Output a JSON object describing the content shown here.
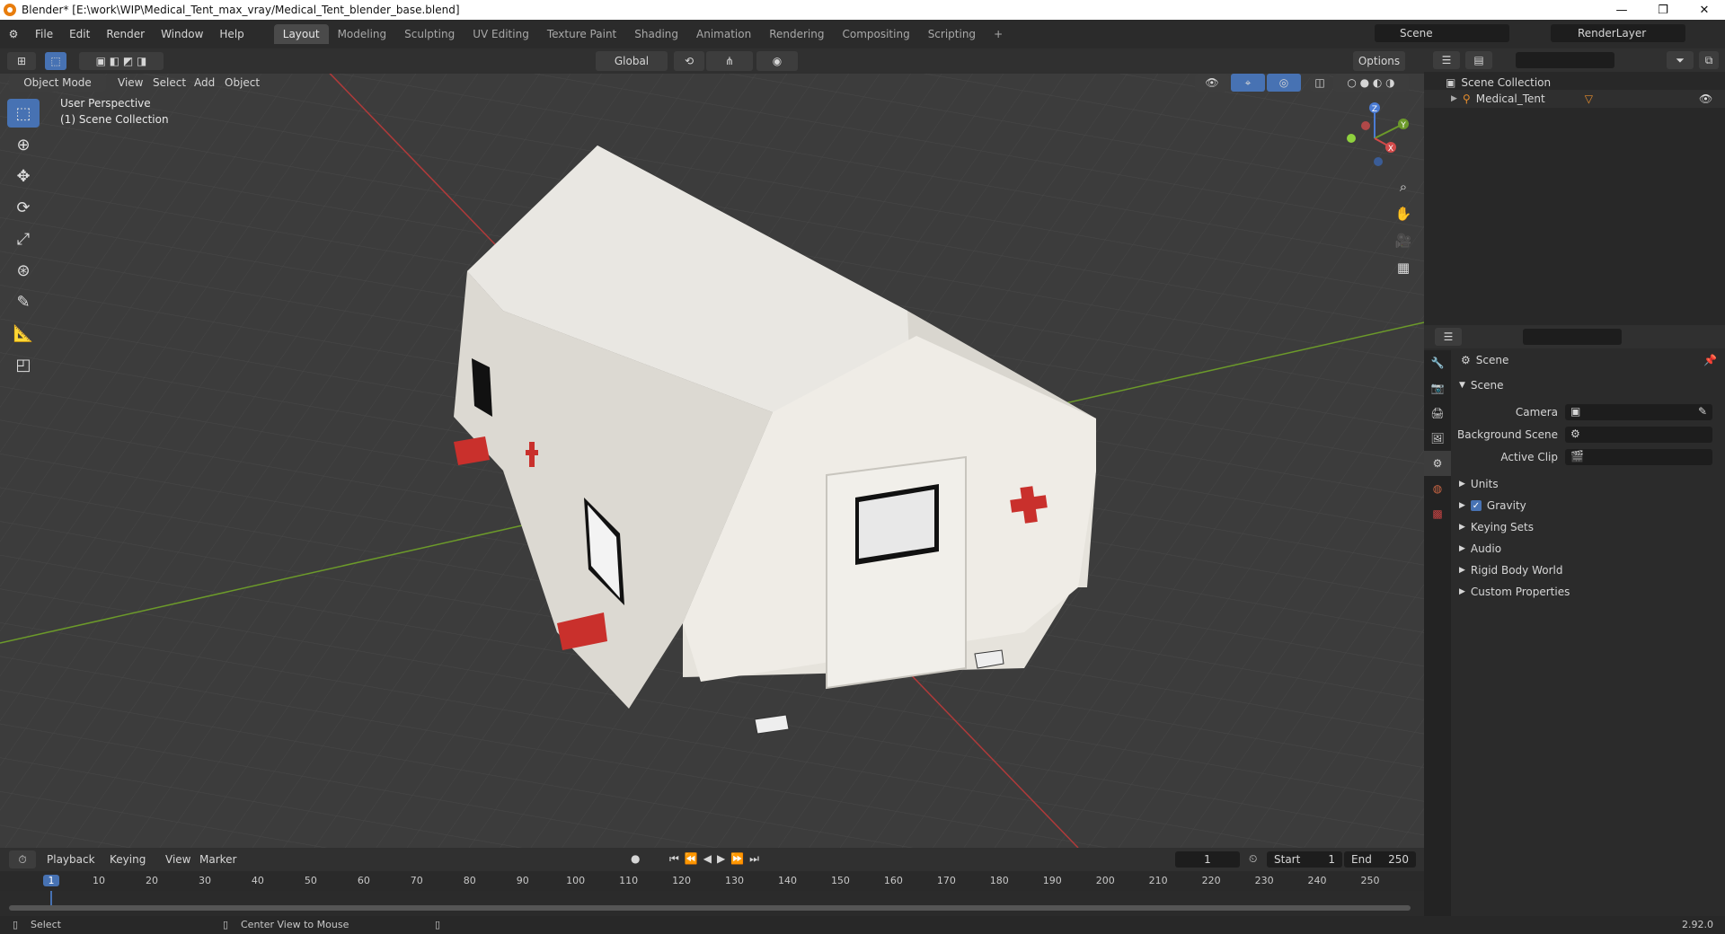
{
  "titlebar": {
    "title": "Blender* [E:\\work\\WIP\\Medical_Tent_max_vray/Medical_Tent_blender_base.blend]"
  },
  "menu": {
    "file": "File",
    "edit": "Edit",
    "render": "Render",
    "window": "Window",
    "help": "Help"
  },
  "workspaces": [
    "Layout",
    "Modeling",
    "Sculpting",
    "UV Editing",
    "Texture Paint",
    "Shading",
    "Animation",
    "Rendering",
    "Compositing",
    "Scripting"
  ],
  "scene_field": "Scene",
  "renderlayer_field": "RenderLayer",
  "header3d": {
    "mode": "Object Mode",
    "view": "View",
    "select": "Select",
    "add": "Add",
    "object": "Object",
    "orientation": "Global",
    "options": "Options"
  },
  "viewport": {
    "perspective": "User Perspective",
    "collection": "(1) Scene Collection",
    "bg": "#3d3d3d",
    "gizmo_x": "X",
    "gizmo_y": "Y",
    "gizmo_z": "Z"
  },
  "outliner": {
    "root": "Scene Collection",
    "item": "Medical_Tent"
  },
  "properties": {
    "context": "Scene",
    "panel": "Scene",
    "camera_label": "Camera",
    "bg_scene_label": "Background Scene",
    "active_clip_label": "Active Clip",
    "sections": [
      "Units",
      "Gravity",
      "Keying Sets",
      "Audio",
      "Rigid Body World",
      "Custom Properties"
    ]
  },
  "timeline": {
    "playback": "Playback",
    "keying": "Keying",
    "view": "View",
    "marker": "Marker",
    "current_frame": "1",
    "start_label": "Start",
    "start": "1",
    "end_label": "End",
    "end": "250",
    "ticks": [
      "1",
      "10",
      "20",
      "30",
      "40",
      "50",
      "60",
      "70",
      "80",
      "90",
      "100",
      "110",
      "120",
      "130",
      "140",
      "150",
      "160",
      "170",
      "180",
      "190",
      "200",
      "210",
      "220",
      "230",
      "240",
      "250"
    ]
  },
  "status": {
    "select": "Select",
    "center_view": "Center View to Mouse",
    "version": "2.92.0"
  },
  "colors": {
    "accent": "#4772b3",
    "x_axis": "#b03a3a",
    "y_axis": "#6c9a2a"
  }
}
